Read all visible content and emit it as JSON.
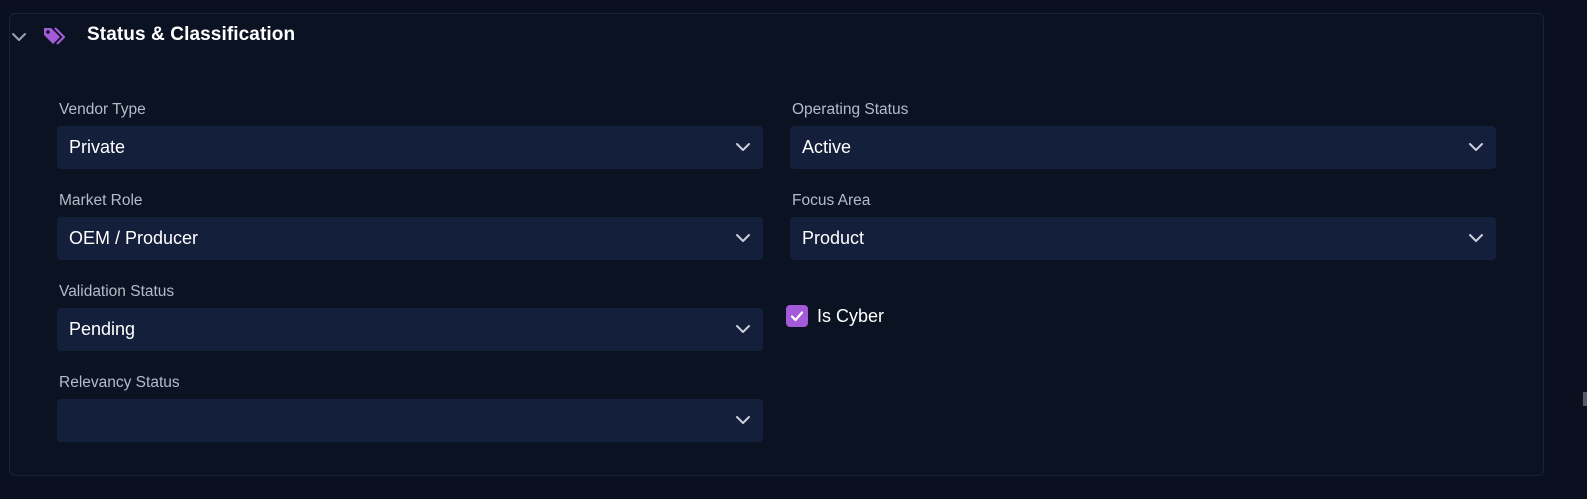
{
  "section": {
    "title": "Status & Classification",
    "expanded": true,
    "accent_color": "#a55bd9"
  },
  "fields": {
    "vendor_type": {
      "label": "Vendor Type",
      "value": "Private"
    },
    "operating_status": {
      "label": "Operating Status",
      "value": "Active"
    },
    "market_role": {
      "label": "Market Role",
      "value": "OEM / Producer"
    },
    "focus_area": {
      "label": "Focus Area",
      "value": "Product"
    },
    "validation_status": {
      "label": "Validation Status",
      "value": "Pending"
    },
    "relevancy_status": {
      "label": "Relevancy Status",
      "value": ""
    },
    "is_cyber": {
      "label": "Is Cyber",
      "checked": true
    }
  },
  "icons": {
    "collapse": "chevron-down-icon",
    "section": "tag-icon",
    "dropdown": "chevron-down-icon",
    "check": "check-icon"
  }
}
